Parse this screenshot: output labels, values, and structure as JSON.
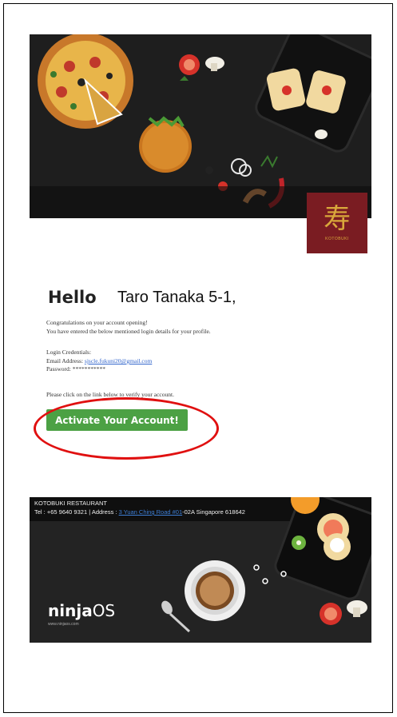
{
  "brand": {
    "logo_text": "KOTOBUKI",
    "logo_kanji": "寿"
  },
  "greeting": {
    "hello": "Hello",
    "name": "Taro Tanaka 5-1,"
  },
  "body": {
    "congrats": "Congratulations on your account opening!",
    "entered": "You have entered the below mentioned login details for your profile.",
    "credentials_heading": "Login Credentials:",
    "email_label": "Email Address:",
    "email_value": "sjscle.fukuni20@gmail.com",
    "password_label": "Password:",
    "password_value": "***********",
    "verify_prompt": "Please click on the link below to verify your account.",
    "activate_label": "Activate Your Account!"
  },
  "footer": {
    "restaurant_name": "KOTOBUKI RESTAURANT",
    "tel_label": "Tel :",
    "tel_value": "+65 9640 9321",
    "address_label": "| Address :",
    "address_link": "3 Yuan Ching Road #01",
    "address_rest": "-02A Singapore 618642",
    "powered_logo": "ninja",
    "powered_logo_os": "OS",
    "powered_url": "www.ninjaos.com"
  },
  "colors": {
    "activate_button": "#4ca144",
    "annotation_circle": "#e01010",
    "logo_badge": "#7a1c22",
    "link": "#3366cc"
  },
  "icons": [
    "pizza-icon",
    "burger-icon",
    "tomato-icon",
    "mushroom-icon",
    "toast-plate-icon",
    "coffee-cup-icon",
    "spoon-icon",
    "orange-icon",
    "kiwi-icon"
  ]
}
